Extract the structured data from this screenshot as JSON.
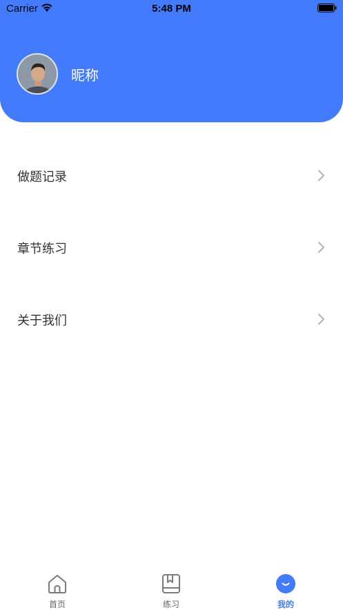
{
  "status_bar": {
    "carrier": "Carrier",
    "time": "5:48 PM",
    "wifi_icon": "wifi-icon",
    "battery_icon": "battery-icon"
  },
  "profile": {
    "avatar_icon": "avatar-photo",
    "nickname": "昵称"
  },
  "menu": [
    {
      "label": "做题记录",
      "icon": "chevron-right-icon"
    },
    {
      "label": "章节练习",
      "icon": "chevron-right-icon"
    },
    {
      "label": "关于我们",
      "icon": "chevron-right-icon"
    }
  ],
  "tab_bar": {
    "tabs": [
      {
        "label": "首页",
        "icon": "home-icon",
        "active": false
      },
      {
        "label": "练习",
        "icon": "book-icon",
        "active": false
      },
      {
        "label": "我的",
        "icon": "smile-icon",
        "active": true
      }
    ]
  },
  "colors": {
    "accent": "#437bfe",
    "text": "#333333",
    "tab_inactive": "#666666"
  }
}
